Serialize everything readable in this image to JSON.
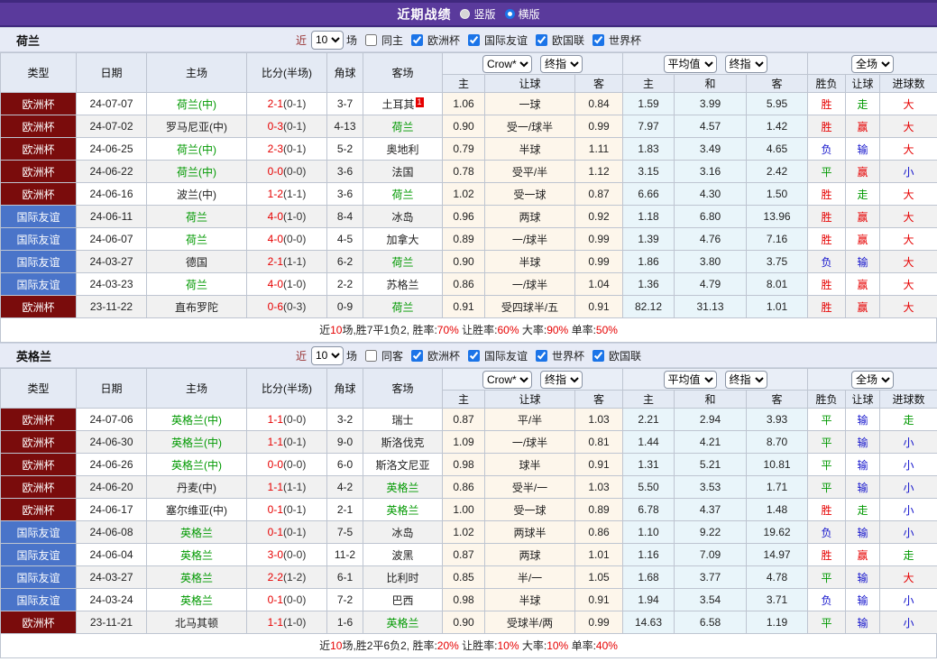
{
  "colors": {
    "header_purple": "#5A3A9C",
    "euro_cup_bg": "#7A0C0C",
    "friendly_bg": "#4A74C9",
    "win_red": "#E60000",
    "draw_green": "#009900",
    "lose_blue": "#1414CC",
    "team_green": "#009900",
    "score_red": "#E60000"
  },
  "top_bar": {
    "title": "近期战绩",
    "layout_options": [
      {
        "label": "竖版",
        "selected": false
      },
      {
        "label": "横版",
        "selected": true
      }
    ]
  },
  "filter": {
    "near": "近",
    "count": "10",
    "unit": "场"
  },
  "dropdowns": {
    "odds_company": "Crow*",
    "odds_stage": "终指",
    "avg_company": "平均值",
    "avg_stage": "终指",
    "scope": "全场"
  },
  "columns": {
    "type": "类型",
    "date": "日期",
    "home": "主场",
    "score": "比分(半场)",
    "corner": "角球",
    "away": "客场",
    "odds_home": "主",
    "handicap": "让球",
    "odds_away": "客",
    "avg_home": "主",
    "avg_draw": "和",
    "avg_away": "客",
    "result": "胜负",
    "handicap_result": "让球",
    "goals": "进球数"
  },
  "sections": [
    {
      "team": "荷兰",
      "same_side_label": "同主",
      "same_side_checked": false,
      "league_filters": [
        "欧洲杯",
        "国际友谊",
        "欧国联",
        "世界杯"
      ],
      "rows": [
        {
          "type": "欧洲杯",
          "date": "24-07-07",
          "home": "荷兰(中)",
          "home_green": true,
          "score": "2-1",
          "half": "(0-1)",
          "corner": "3-7",
          "away": "土耳其",
          "away_green": false,
          "away_badge": "1",
          "odds_home": "1.06",
          "handicap": "一球",
          "odds_away": "0.84",
          "avg_home": "1.59",
          "avg_draw": "3.99",
          "avg_away": "5.95",
          "result": "胜",
          "handicap_result": "走",
          "goals": "大"
        },
        {
          "type": "欧洲杯",
          "date": "24-07-02",
          "home": "罗马尼亚(中)",
          "home_green": false,
          "score": "0-3",
          "half": "(0-1)",
          "corner": "4-13",
          "away": "荷兰",
          "away_green": true,
          "odds_home": "0.90",
          "handicap": "受一/球半",
          "odds_away": "0.99",
          "avg_home": "7.97",
          "avg_draw": "4.57",
          "avg_away": "1.42",
          "result": "胜",
          "handicap_result": "赢",
          "goals": "大"
        },
        {
          "type": "欧洲杯",
          "date": "24-06-25",
          "home": "荷兰(中)",
          "home_green": true,
          "score": "2-3",
          "half": "(0-1)",
          "corner": "5-2",
          "away": "奥地利",
          "away_green": false,
          "odds_home": "0.79",
          "handicap": "半球",
          "odds_away": "1.11",
          "avg_home": "1.83",
          "avg_draw": "3.49",
          "avg_away": "4.65",
          "result": "负",
          "handicap_result": "输",
          "goals": "大"
        },
        {
          "type": "欧洲杯",
          "date": "24-06-22",
          "home": "荷兰(中)",
          "home_green": true,
          "score": "0-0",
          "half": "(0-0)",
          "corner": "3-6",
          "away": "法国",
          "away_green": false,
          "odds_home": "0.78",
          "handicap": "受平/半",
          "odds_away": "1.12",
          "avg_home": "3.15",
          "avg_draw": "3.16",
          "avg_away": "2.42",
          "result": "平",
          "handicap_result": "赢",
          "goals": "小"
        },
        {
          "type": "欧洲杯",
          "date": "24-06-16",
          "home": "波兰(中)",
          "home_green": false,
          "score": "1-2",
          "half": "(1-1)",
          "corner": "3-6",
          "away": "荷兰",
          "away_green": true,
          "odds_home": "1.02",
          "handicap": "受一球",
          "odds_away": "0.87",
          "avg_home": "6.66",
          "avg_draw": "4.30",
          "avg_away": "1.50",
          "result": "胜",
          "handicap_result": "走",
          "goals": "大"
        },
        {
          "type": "国际友谊",
          "date": "24-06-11",
          "home": "荷兰",
          "home_green": true,
          "score": "4-0",
          "half": "(1-0)",
          "corner": "8-4",
          "away": "冰岛",
          "away_green": false,
          "odds_home": "0.96",
          "handicap": "两球",
          "odds_away": "0.92",
          "avg_home": "1.18",
          "avg_draw": "6.80",
          "avg_away": "13.96",
          "result": "胜",
          "handicap_result": "赢",
          "goals": "大"
        },
        {
          "type": "国际友谊",
          "date": "24-06-07",
          "home": "荷兰",
          "home_green": true,
          "score": "4-0",
          "half": "(0-0)",
          "corner": "4-5",
          "away": "加拿大",
          "away_green": false,
          "odds_home": "0.89",
          "handicap": "一/球半",
          "odds_away": "0.99",
          "avg_home": "1.39",
          "avg_draw": "4.76",
          "avg_away": "7.16",
          "result": "胜",
          "handicap_result": "赢",
          "goals": "大"
        },
        {
          "type": "国际友谊",
          "date": "24-03-27",
          "home": "德国",
          "home_green": false,
          "score": "2-1",
          "half": "(1-1)",
          "corner": "6-2",
          "away": "荷兰",
          "away_green": true,
          "odds_home": "0.90",
          "handicap": "半球",
          "odds_away": "0.99",
          "avg_home": "1.86",
          "avg_draw": "3.80",
          "avg_away": "3.75",
          "result": "负",
          "handicap_result": "输",
          "goals": "大"
        },
        {
          "type": "国际友谊",
          "date": "24-03-23",
          "home": "荷兰",
          "home_green": true,
          "score": "4-0",
          "half": "(1-0)",
          "corner": "2-2",
          "away": "苏格兰",
          "away_green": false,
          "odds_home": "0.86",
          "handicap": "一/球半",
          "odds_away": "1.04",
          "avg_home": "1.36",
          "avg_draw": "4.79",
          "avg_away": "8.01",
          "result": "胜",
          "handicap_result": "赢",
          "goals": "大"
        },
        {
          "type": "欧洲杯",
          "date": "23-11-22",
          "home": "直布罗陀",
          "home_green": false,
          "score": "0-6",
          "half": "(0-3)",
          "corner": "0-9",
          "away": "荷兰",
          "away_green": true,
          "odds_home": "0.91",
          "handicap": "受四球半/五",
          "odds_away": "0.91",
          "avg_home": "82.12",
          "avg_draw": "31.13",
          "avg_away": "1.01",
          "result": "胜",
          "handicap_result": "赢",
          "goals": "大"
        }
      ],
      "summary": [
        {
          "text": "近",
          "red": false
        },
        {
          "text": "10",
          "red": true
        },
        {
          "text": "场,胜7平1负2, 胜率:",
          "red": false
        },
        {
          "text": "70%",
          "red": true
        },
        {
          "text": " 让胜率:",
          "red": false
        },
        {
          "text": "60%",
          "red": true
        },
        {
          "text": " 大率:",
          "red": false
        },
        {
          "text": "90%",
          "red": true
        },
        {
          "text": " 单率:",
          "red": false
        },
        {
          "text": "50%",
          "red": true
        }
      ]
    },
    {
      "team": "英格兰",
      "same_side_label": "同客",
      "same_side_checked": false,
      "league_filters": [
        "欧洲杯",
        "国际友谊",
        "世界杯",
        "欧国联"
      ],
      "rows": [
        {
          "type": "欧洲杯",
          "date": "24-07-06",
          "home": "英格兰(中)",
          "home_green": true,
          "score": "1-1",
          "half": "(0-0)",
          "corner": "3-2",
          "away": "瑞士",
          "away_green": false,
          "odds_home": "0.87",
          "handicap": "平/半",
          "odds_away": "1.03",
          "avg_home": "2.21",
          "avg_draw": "2.94",
          "avg_away": "3.93",
          "result": "平",
          "handicap_result": "输",
          "goals": "走"
        },
        {
          "type": "欧洲杯",
          "date": "24-06-30",
          "home": "英格兰(中)",
          "home_green": true,
          "score": "1-1",
          "half": "(0-1)",
          "corner": "9-0",
          "away": "斯洛伐克",
          "away_green": false,
          "odds_home": "1.09",
          "handicap": "一/球半",
          "odds_away": "0.81",
          "avg_home": "1.44",
          "avg_draw": "4.21",
          "avg_away": "8.70",
          "result": "平",
          "handicap_result": "输",
          "goals": "小"
        },
        {
          "type": "欧洲杯",
          "date": "24-06-26",
          "home": "英格兰(中)",
          "home_green": true,
          "score": "0-0",
          "half": "(0-0)",
          "corner": "6-0",
          "away": "斯洛文尼亚",
          "away_green": false,
          "odds_home": "0.98",
          "handicap": "球半",
          "odds_away": "0.91",
          "avg_home": "1.31",
          "avg_draw": "5.21",
          "avg_away": "10.81",
          "result": "平",
          "handicap_result": "输",
          "goals": "小"
        },
        {
          "type": "欧洲杯",
          "date": "24-06-20",
          "home": "丹麦(中)",
          "home_green": false,
          "score": "1-1",
          "half": "(1-1)",
          "corner": "4-2",
          "away": "英格兰",
          "away_green": true,
          "odds_home": "0.86",
          "handicap": "受半/一",
          "odds_away": "1.03",
          "avg_home": "5.50",
          "avg_draw": "3.53",
          "avg_away": "1.71",
          "result": "平",
          "handicap_result": "输",
          "goals": "小"
        },
        {
          "type": "欧洲杯",
          "date": "24-06-17",
          "home": "塞尔维亚(中)",
          "home_green": false,
          "score": "0-1",
          "half": "(0-1)",
          "corner": "2-1",
          "away": "英格兰",
          "away_green": true,
          "odds_home": "1.00",
          "handicap": "受一球",
          "odds_away": "0.89",
          "avg_home": "6.78",
          "avg_draw": "4.37",
          "avg_away": "1.48",
          "result": "胜",
          "handicap_result": "走",
          "goals": "小"
        },
        {
          "type": "国际友谊",
          "date": "24-06-08",
          "home": "英格兰",
          "home_green": true,
          "score": "0-1",
          "half": "(0-1)",
          "corner": "7-5",
          "away": "冰岛",
          "away_green": false,
          "odds_home": "1.02",
          "handicap": "两球半",
          "odds_away": "0.86",
          "avg_home": "1.10",
          "avg_draw": "9.22",
          "avg_away": "19.62",
          "result": "负",
          "handicap_result": "输",
          "goals": "小"
        },
        {
          "type": "国际友谊",
          "date": "24-06-04",
          "home": "英格兰",
          "home_green": true,
          "score": "3-0",
          "half": "(0-0)",
          "corner": "11-2",
          "away": "波黑",
          "away_green": false,
          "odds_home": "0.87",
          "handicap": "两球",
          "odds_away": "1.01",
          "avg_home": "1.16",
          "avg_draw": "7.09",
          "avg_away": "14.97",
          "result": "胜",
          "handicap_result": "赢",
          "goals": "走"
        },
        {
          "type": "国际友谊",
          "date": "24-03-27",
          "home": "英格兰",
          "home_green": true,
          "score": "2-2",
          "half": "(1-2)",
          "corner": "6-1",
          "away": "比利时",
          "away_green": false,
          "odds_home": "0.85",
          "handicap": "半/一",
          "odds_away": "1.05",
          "avg_home": "1.68",
          "avg_draw": "3.77",
          "avg_away": "4.78",
          "result": "平",
          "handicap_result": "输",
          "goals": "大"
        },
        {
          "type": "国际友谊",
          "date": "24-03-24",
          "home": "英格兰",
          "home_green": true,
          "score": "0-1",
          "half": "(0-0)",
          "corner": "7-2",
          "away": "巴西",
          "away_green": false,
          "odds_home": "0.98",
          "handicap": "半球",
          "odds_away": "0.91",
          "avg_home": "1.94",
          "avg_draw": "3.54",
          "avg_away": "3.71",
          "result": "负",
          "handicap_result": "输",
          "goals": "小"
        },
        {
          "type": "欧洲杯",
          "date": "23-11-21",
          "home": "北马其顿",
          "home_green": false,
          "score": "1-1",
          "half": "(1-0)",
          "corner": "1-6",
          "away": "英格兰",
          "away_green": true,
          "odds_home": "0.90",
          "handicap": "受球半/两",
          "odds_away": "0.99",
          "avg_home": "14.63",
          "avg_draw": "6.58",
          "avg_away": "1.19",
          "result": "平",
          "handicap_result": "输",
          "goals": "小"
        }
      ],
      "summary": [
        {
          "text": "近",
          "red": false
        },
        {
          "text": "10",
          "red": true
        },
        {
          "text": "场,胜2平6负2, 胜率:",
          "red": false
        },
        {
          "text": "20%",
          "red": true
        },
        {
          "text": " 让胜率:",
          "red": false
        },
        {
          "text": "10%",
          "red": true
        },
        {
          "text": " 大率:",
          "red": false
        },
        {
          "text": "10%",
          "red": true
        },
        {
          "text": " 单率:",
          "red": false
        },
        {
          "text": "40%",
          "red": true
        }
      ]
    }
  ]
}
